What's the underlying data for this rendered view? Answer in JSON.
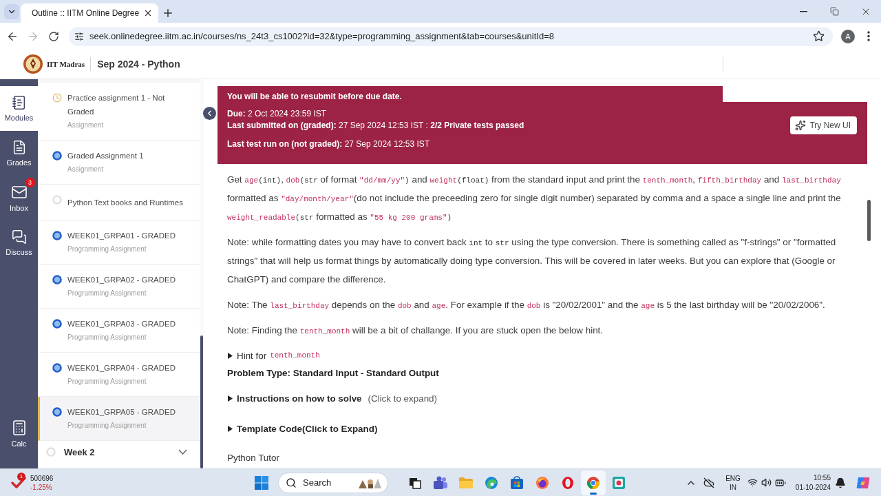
{
  "browser": {
    "tabs": [
      {
        "title": "Outline :: IITM Online Degree",
        "selected": true
      }
    ],
    "back": {
      "disabled": false
    },
    "forward": {
      "disabled": true
    },
    "url": "seek.onlinedegree.iitm.ac.in/courses/ns_24t3_cs1002?id=32&type=programming_assignment&tab=courses&unitId=8",
    "profile": "A"
  },
  "header": {
    "logo_text": "IIT Madras",
    "course": "Sep 2024 - Python"
  },
  "rail": {
    "items": [
      {
        "label": "Modules",
        "selected": true
      },
      {
        "label": "Grades",
        "selected": false
      },
      {
        "label": "Inbox",
        "selected": false,
        "badge": "3"
      },
      {
        "label": "Discuss",
        "selected": false
      }
    ],
    "bottom": {
      "label": "Calc",
      "selected": false
    }
  },
  "sidebar": {
    "items": [
      {
        "kind": "pending",
        "title": "Practice assignment 1 - Not Graded",
        "subtitle": "Assignment",
        "selected": false
      },
      {
        "kind": "done",
        "title": "Graded Assignment 1",
        "subtitle": "Assignment",
        "selected": false
      },
      {
        "kind": "unstarted",
        "title": "Python Text books and Runtimes",
        "selected": false
      },
      {
        "kind": "done",
        "title": "WEEK01_GRPA01 - GRADED",
        "subtitle": "Programming Assignment",
        "selected": false
      },
      {
        "kind": "done",
        "title": "WEEK01_GRPA02 - GRADED",
        "subtitle": "Programming Assignment",
        "selected": false
      },
      {
        "kind": "done",
        "title": "WEEK01_GRPA03 - GRADED",
        "subtitle": "Programming Assignment",
        "selected": false
      },
      {
        "kind": "done",
        "title": "WEEK01_GRPA04 - GRADED",
        "subtitle": "Programming Assignment",
        "selected": false
      },
      {
        "kind": "done",
        "title": "WEEK01_GRPA05 - GRADED",
        "subtitle": "Programming Assignment",
        "selected": true
      }
    ],
    "week": {
      "title": "Week 2",
      "completed": false,
      "expanded": false
    }
  },
  "banner": {
    "notice": "You will be able to resubmit before due date.",
    "submission": [
      "**Due:** 2 Oct 2024 23:59 IST",
      "**Last submitted on (graded):** 27 Sep 2024 12:53 IST : **2/2 Private tests passed**"
    ],
    "last_run": "**Last test run on (not graded):** 27 Sep 2024 12:53 IST",
    "button": "Try New UI"
  },
  "problem": {
    "paragraphs": [
      [
        {
          "kind": "text",
          "text": "Get "
        },
        {
          "kind": "code",
          "text": "age"
        },
        {
          "kind": "type",
          "text": "(int)"
        },
        {
          "kind": "text",
          "text": ", "
        },
        {
          "kind": "code",
          "text": "dob"
        },
        {
          "kind": "type",
          "text": "(str"
        },
        {
          "kind": "text",
          "text": " of format "
        },
        {
          "kind": "code",
          "text": "\"dd/mm/yy\""
        },
        {
          "kind": "type",
          "text": ")"
        },
        {
          "kind": "text",
          "text": " and "
        },
        {
          "kind": "code",
          "text": "weight"
        },
        {
          "kind": "type",
          "text": "(float)"
        },
        {
          "kind": "text",
          "text": " from the standard input and print the "
        },
        {
          "kind": "code",
          "text": "tenth_month"
        },
        {
          "kind": "text",
          "text": ", "
        },
        {
          "kind": "code",
          "text": "fifth_birthday"
        },
        {
          "kind": "text",
          "text": " and "
        },
        {
          "kind": "code",
          "text": "last_birthday"
        },
        {
          "kind": "text",
          "text": " formatted as "
        },
        {
          "kind": "code",
          "text": "\"day/month/year\""
        },
        {
          "kind": "text",
          "text": "(do not include the preceeding zero for single digit number) separated by comma and a space a single line and print the "
        },
        {
          "kind": "code",
          "text": "weight_readable"
        },
        {
          "kind": "type",
          "text": "(str"
        },
        {
          "kind": "text",
          "text": " formatted as "
        },
        {
          "kind": "code",
          "text": "\"55 kg 200 grams\""
        },
        {
          "kind": "type",
          "text": ")"
        }
      ],
      [
        {
          "kind": "text",
          "text": "Note: while formatting dates you may have to convert back "
        },
        {
          "kind": "type",
          "text": "int"
        },
        {
          "kind": "text",
          "text": " to "
        },
        {
          "kind": "type",
          "text": "str"
        },
        {
          "kind": "text",
          "text": " using the type conversion. There is something called as \"f-strings\" or \"formatted strings\" that will help us format things by automatically doing type conversion. This will be covered in later weeks. But you can explore that (Google or ChatGPT) and compare the difference."
        }
      ],
      [
        {
          "kind": "text",
          "text": "Note: The "
        },
        {
          "kind": "code",
          "text": "last_birthday"
        },
        {
          "kind": "text",
          "text": " depends on the "
        },
        {
          "kind": "code",
          "text": "dob"
        },
        {
          "kind": "text",
          "text": " and "
        },
        {
          "kind": "code",
          "text": "age"
        },
        {
          "kind": "text",
          "text": ". For example if the "
        },
        {
          "kind": "code",
          "text": "dob"
        },
        {
          "kind": "text",
          "text": " is \"20/02/2001\" and the "
        },
        {
          "kind": "code",
          "text": "age"
        },
        {
          "kind": "text",
          "text": " is 5 the last birthday will be \"20/02/2006\"."
        }
      ],
      [
        {
          "kind": "text",
          "text": "Note: Finding the "
        },
        {
          "kind": "code",
          "text": "tenth_month"
        },
        {
          "kind": "text",
          "text": " will be a bit of challange. If you are stuck open the below hint."
        }
      ]
    ],
    "hint": {
      "label": "Hint for",
      "code": "tenth_month",
      "expanded": false
    },
    "problem_type": "Problem Type: Standard Input - Standard Output",
    "sections": [
      {
        "title": "Instructions on how to solve",
        "note": "(Click to expand)",
        "expanded": false
      },
      {
        "title": "Template Code(Click to Expand)",
        "expanded": false
      }
    ],
    "footer": "Python Tutor"
  },
  "taskbar": {
    "stock": {
      "badge": "1",
      "value": "500696",
      "change": "-1.25%"
    },
    "search": {
      "placeholder": "Search"
    },
    "apps": [
      {
        "selected": false
      },
      {
        "selected": false
      },
      {
        "selected": false
      },
      {
        "selected": false
      },
      {
        "selected": false
      },
      {
        "selected": false
      },
      {
        "selected": false
      },
      {
        "selected": true
      },
      {
        "selected": false
      }
    ],
    "tray": {
      "language": "ENG",
      "region": "IN",
      "time": "10:55",
      "date": "01-10-2024"
    }
  }
}
